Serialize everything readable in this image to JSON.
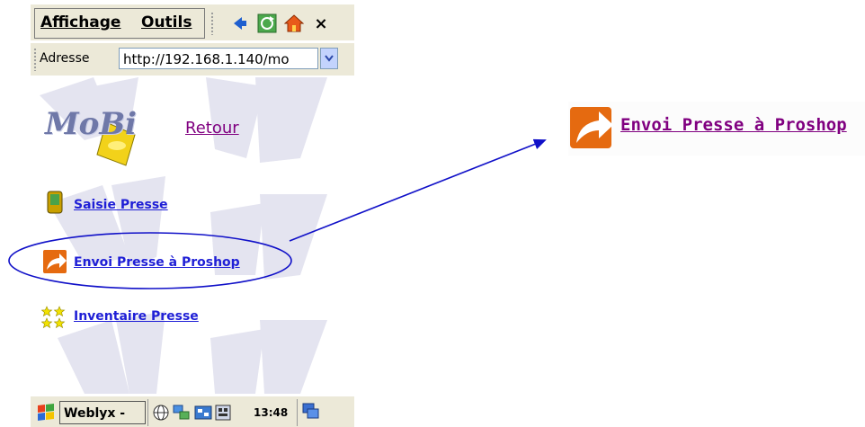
{
  "menubar": {
    "items": [
      "Affichage",
      "Outils"
    ]
  },
  "toolbar": {
    "close_label": "×"
  },
  "address": {
    "label": "Adresse",
    "value": "http://192.168.1.140/mo"
  },
  "content": {
    "logo_text": "MoBi",
    "retour_label": "Retour",
    "links": [
      {
        "label": "Saisie Presse"
      },
      {
        "label": "Envoi Presse à Proshop"
      },
      {
        "label": "Inventaire Presse"
      }
    ]
  },
  "taskbar": {
    "task_label": "Weblyx - (...",
    "clock": "13:48"
  },
  "callout": {
    "label": "Envoi Presse à Proshop"
  },
  "colors": {
    "link": "#1f1fd6",
    "visited": "#800080",
    "annotation": "#1010c8",
    "chrome": "#ece9d8"
  }
}
